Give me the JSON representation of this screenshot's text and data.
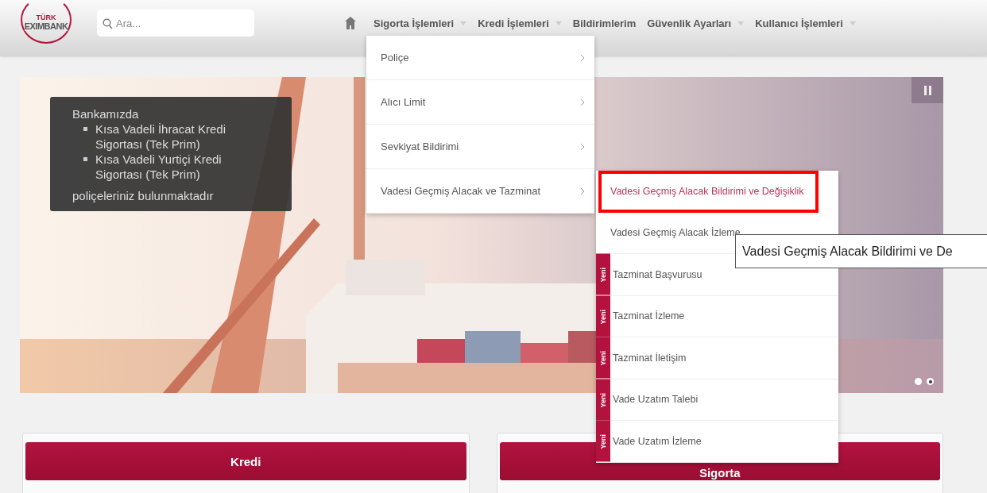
{
  "header": {
    "logo": {
      "top": "TÜRK",
      "name": "EXIMBANK"
    },
    "search": {
      "placeholder": "Ara..."
    },
    "nav": [
      {
        "label": "Sigorta İşlemleri",
        "dropdown": true
      },
      {
        "label": "Kredi İşlemleri",
        "dropdown": true
      },
      {
        "label": "Bildirimlerim",
        "dropdown": false
      },
      {
        "label": "Güvenlik Ayarları",
        "dropdown": true
      },
      {
        "label": "Kullanıcı İşlemleri",
        "dropdown": true
      }
    ]
  },
  "slider": {
    "caption": {
      "title": "Bankamızda",
      "items": [
        "Kısa Vadeli İhracat Kredi Sigortası (Tek Prim)",
        "Kısa Vadeli Yurtiçi Kredi Sigortası (Tek Prim)"
      ],
      "footer": "poliçeleriniz bulunmaktadır"
    },
    "dots": [
      {
        "selected": false
      },
      {
        "selected": true
      }
    ]
  },
  "cards": [
    {
      "title": "Kredi"
    },
    {
      "title": "Sigorta"
    }
  ],
  "menu": {
    "items": [
      {
        "label": "Poliçe"
      },
      {
        "label": "Alıcı Limit"
      },
      {
        "label": "Sevkiyat Bildirimi"
      },
      {
        "label": "Vadesi Geçmiş Alacak ve Tazminat"
      }
    ]
  },
  "submenu": {
    "items": [
      {
        "label": "Vadesi Geçmiş Alacak Bildirimi ve Değişiklik",
        "selected": true
      },
      {
        "label": "Vadesi Geçmiş Alacak İzleme",
        "selected": false
      },
      {
        "label": "Tazminat Başvurusu",
        "selected": false,
        "badge": "Yeni"
      },
      {
        "label": "Tazminat İzleme",
        "selected": false,
        "badge": "Yeni"
      },
      {
        "label": "Tazminat İletişim",
        "selected": false,
        "badge": "Yeni"
      },
      {
        "label": "Vade Uzatım Talebi",
        "selected": false,
        "badge": "Yeni"
      },
      {
        "label": "Vade Uzatım İzleme",
        "selected": false,
        "badge": "Yeni"
      }
    ]
  },
  "tooltip": {
    "text": "Vadesi Geçmiş Alacak Bildirimi ve De"
  }
}
